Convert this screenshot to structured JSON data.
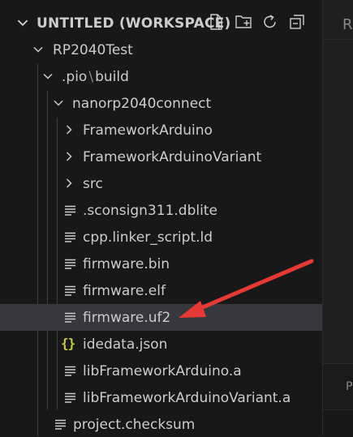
{
  "workspace": {
    "title": "UNTITLED (WORKSPACE)",
    "actions": [
      {
        "name": "new-file-icon"
      },
      {
        "name": "new-folder-icon"
      },
      {
        "name": "refresh-icon"
      },
      {
        "name": "collapse-all-icon"
      }
    ]
  },
  "tree": {
    "root": "RP2040Test",
    "pio_folder": ".pio",
    "build_folder": "build",
    "board_folder": "nanorp2040connect",
    "folders": [
      "FrameworkArduino",
      "FrameworkArduinoVariant",
      "src"
    ],
    "files": [
      "sconsign311.dblite",
      "cpp.linker_script.ld",
      "firmware.bin",
      "firmware.elf",
      "firmware.uf2",
      "idedata.json",
      "libFrameworkArduino.a",
      "libFrameworkArduinoVariant.a"
    ],
    "root_file": "project.checksum",
    "json_icon_glyph": "{}"
  },
  "right_panel": {
    "tab_letter": "R",
    "lower_letter": "P"
  },
  "colors": {
    "selection": "#37373d",
    "annotation_arrow": "#e53935",
    "json_icon": "#cbcb41"
  }
}
